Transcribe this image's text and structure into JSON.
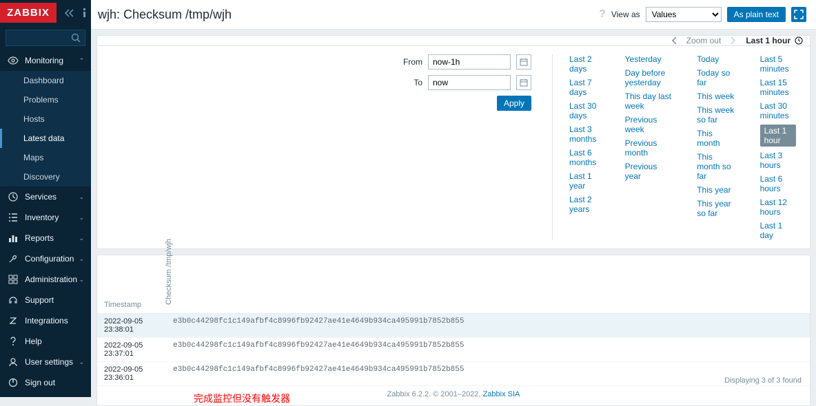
{
  "brand": "ZABBIX",
  "search": {
    "placeholder": ""
  },
  "nav": {
    "monitoring": "Monitoring",
    "sub": {
      "dashboard": "Dashboard",
      "problems": "Problems",
      "hosts": "Hosts",
      "latest": "Latest data",
      "maps": "Maps",
      "discovery": "Discovery"
    },
    "services": "Services",
    "inventory": "Inventory",
    "reports": "Reports",
    "configuration": "Configuration",
    "administration": "Administration",
    "support": "Support",
    "integrations": "Integrations",
    "help": "Help",
    "usersettings": "User settings",
    "signout": "Sign out"
  },
  "header": {
    "title": "wjh: Checksum /tmp/wjh",
    "viewas_label": "View as",
    "viewas_value": "Values",
    "plain_text": "As plain text"
  },
  "timenav": {
    "zoom": "Zoom out",
    "range": "Last 1 hour"
  },
  "filter": {
    "from_label": "From",
    "from_value": "now-1h",
    "to_label": "To",
    "to_value": "now",
    "apply": "Apply",
    "col1": [
      "Last 2 days",
      "Last 7 days",
      "Last 30 days",
      "Last 3 months",
      "Last 6 months",
      "Last 1 year",
      "Last 2 years"
    ],
    "col2": [
      "Yesterday",
      "Day before yesterday",
      "This day last week",
      "Previous week",
      "Previous month",
      "Previous year"
    ],
    "col3": [
      "Today",
      "Today so far",
      "This week",
      "This week so far",
      "This month",
      "This month so far",
      "This year",
      "This year so far"
    ],
    "col4": [
      "Last 5 minutes",
      "Last 15 minutes",
      "Last 30 minutes",
      "Last 1 hour",
      "Last 3 hours",
      "Last 6 hours",
      "Last 12 hours",
      "Last 1 day"
    ],
    "selected": "Last 1 hour"
  },
  "table": {
    "head_timestamp": "Timestamp",
    "head_value": "Checksum /tmp/wjh",
    "rows": [
      {
        "ts": "2022-09-05 23:38:01",
        "val": "e3b0c44298fc1c149afbf4c8996fb92427ae41e4649b934ca495991b7852b855"
      },
      {
        "ts": "2022-09-05 23:37:01",
        "val": "e3b0c44298fc1c149afbf4c8996fb92427ae41e4649b934ca495991b7852b855"
      },
      {
        "ts": "2022-09-05 23:36:01",
        "val": "e3b0c44298fc1c149afbf4c8996fb92427ae41e4649b934ca495991b7852b855"
      }
    ],
    "annotation": "完成监控但没有触发器",
    "count": "Displaying 3 of 3 found"
  },
  "footer": {
    "text": "Zabbix 6.2.2. © 2001–2022, ",
    "link": "Zabbix SIA"
  }
}
